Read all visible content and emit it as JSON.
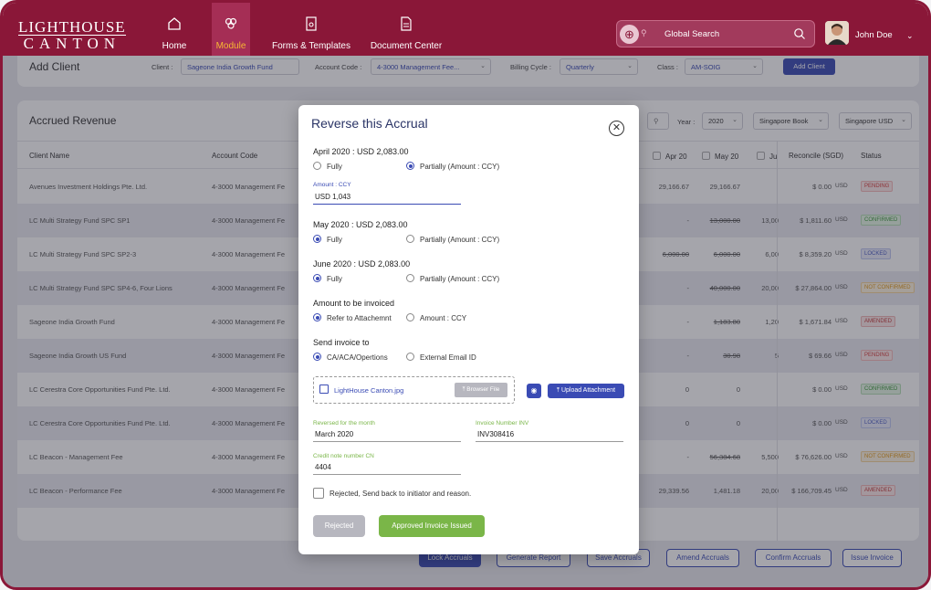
{
  "brand": {
    "line1": "LIGHTHOUSE",
    "line2": "CANTON"
  },
  "nav": [
    {
      "label": "Home",
      "icon": "home-icon"
    },
    {
      "label": "Module",
      "icon": "module-icon",
      "active": true
    },
    {
      "label": "Forms & Templates",
      "icon": "forms-icon"
    },
    {
      "label": "Document Center",
      "icon": "document-icon"
    }
  ],
  "search": {
    "placeholder": "Global Search"
  },
  "user": {
    "name": "John Doe"
  },
  "add_client": {
    "title": "Add Client",
    "client_label": "Client :",
    "client_value": "Sageone India Growth Fund",
    "account_label": "Account Code :",
    "account_value": "4-3000 Management Fee...",
    "billing_label": "Billing Cycle :",
    "billing_value": "Quarterly",
    "class_label": "Class :",
    "class_value": "AM-SOIG",
    "button": "Add Client"
  },
  "accrued": {
    "title": "Accrued Revenue",
    "year_label": "Year :",
    "year_value": "2020",
    "book_value": "Singapore Book",
    "currency_value": "Singapore USD",
    "columns": {
      "client": "Client Name",
      "account": "Account Code",
      "apr": "Apr 20",
      "may": "May 20",
      "jun": "Ju",
      "reconcile": "Reconcile (SGD)",
      "status": "Status"
    },
    "rows": [
      {
        "client": "Avenues Investment Holdings Pte. Ltd.",
        "account": "4-3000 Management Fe",
        "apr": "29,166.67",
        "may": "29,166.67",
        "jun": "",
        "recon": "$ 0.00",
        "cur": "USD",
        "status": "PENDING",
        "type": "pending",
        "may_strike": false,
        "apr_strike": false
      },
      {
        "client": "LC Multi Strategy Fund SPC SP1",
        "account": "4-3000 Management Fe",
        "apr": "-",
        "may": "13,000.00",
        "jun": "13,00",
        "recon": "$ 1,811.60",
        "cur": "USD",
        "status": "CONFIRMED",
        "type": "confirmed",
        "may_strike": true,
        "apr_strike": false
      },
      {
        "client": "LC Multi Strategy Fund SPC SP2-3",
        "account": "4-3000 Management Fe",
        "apr": "6,000.00",
        "may": "6,000.00",
        "jun": "6,00",
        "recon": "$ 8,359.20",
        "cur": "USD",
        "status": "LOCKED",
        "type": "locked",
        "may_strike": true,
        "apr_strike": true
      },
      {
        "client": "LC Multi Strategy Fund SPC SP4-6, Four Lions",
        "account": "4-3000 Management Fe",
        "apr": "-",
        "may": "40,000.00",
        "jun": "20,00",
        "recon": "$ 27,864.00",
        "cur": "USD",
        "status": "NOT CONFIRMED",
        "type": "notconf",
        "may_strike": true,
        "apr_strike": false
      },
      {
        "client": "Sageone India Growth Fund",
        "account": "4-3000 Management Fe",
        "apr": "-",
        "may": "1,183.80",
        "jun": "1,20",
        "recon": "$ 1,671.84",
        "cur": "USD",
        "status": "AMENDED",
        "type": "amended",
        "may_strike": true,
        "apr_strike": false
      },
      {
        "client": "Sageone India Growth US Fund",
        "account": "4-3000 Management Fe",
        "apr": "-",
        "may": "30.98",
        "jun": "5",
        "recon": "$ 69.66",
        "cur": "USD",
        "status": "PENDING",
        "type": "pending",
        "may_strike": true,
        "apr_strike": false
      },
      {
        "client": "LC Cerestra Core Opportunities Fund Pte. Ltd.",
        "account": "4-3000 Management Fe",
        "apr": "0",
        "may": "0",
        "jun": "",
        "recon": "$ 0.00",
        "cur": "USD",
        "status": "CONFIRMED",
        "type": "confirmed",
        "may_strike": false,
        "apr_strike": false
      },
      {
        "client": "LC Cerestra Core Opportunities Fund Pte. Ltd.",
        "account": "4-3000 Management Fe",
        "apr": "0",
        "may": "0",
        "jun": "",
        "recon": "$ 0.00",
        "cur": "USD",
        "status": "LOCKED",
        "type": "locked",
        "may_strike": false,
        "apr_strike": false
      },
      {
        "client": "LC Beacon - Management Fee",
        "account": "4-3000 Management Fe",
        "apr": "-",
        "may": "56,384.68",
        "jun": "5,500",
        "recon": "$ 76,626.00",
        "cur": "USD",
        "status": "NOT CONFIRMED",
        "type": "notconf",
        "may_strike": true,
        "apr_strike": false
      },
      {
        "client": "LC Beacon - Performance Fee",
        "account": "4-3000 Management Fe",
        "apr": "29,339.56",
        "may": "1,481.18",
        "jun": "20,00",
        "recon": "$ 166,709.45",
        "cur": "USD",
        "status": "AMENDED",
        "type": "amended",
        "may_strike": false,
        "apr_strike": false
      }
    ]
  },
  "actions": [
    "Lock Accruals",
    "Generate Report",
    "Save Accruals",
    "Amend Accruals",
    "Confirm Accruals",
    "Issue Invoice"
  ],
  "modal": {
    "title": "Reverse this Accrual",
    "apr_heading": "April 2020 : USD 2,083.00",
    "fully": "Fully",
    "partially": "Partially (Amount : CCY)",
    "amount_label": "Amount : CCY",
    "amount_value": "USD 1,043",
    "may_heading": "May 2020 : USD 2,083.00",
    "jun_heading": "June 2020 : USD 2,083.00",
    "invoiced_heading": "Amount to be invoiced",
    "refer": "Refer to Attachemnt",
    "amount_ccy": "Amount : CCY",
    "send_heading": "Send invoice to",
    "ca": "CA/ACA/Opertions",
    "external": "External Email ID",
    "file_name": "LightHouse Canton.jpg",
    "browse": "Browser File",
    "upload": "Upload Attachment",
    "reversed_label": "Reversed for the month",
    "reversed_value": "March 2020",
    "invoice_label": "Invoice Number INV",
    "invoice_value": "INV308416",
    "credit_label": "Credit note number CN",
    "credit_value": "4404",
    "rejected_check": "Rejected, Send back to initiator and reason.",
    "rejected_btn": "Rejected",
    "approved_btn": "Approved Invoice Issued"
  }
}
